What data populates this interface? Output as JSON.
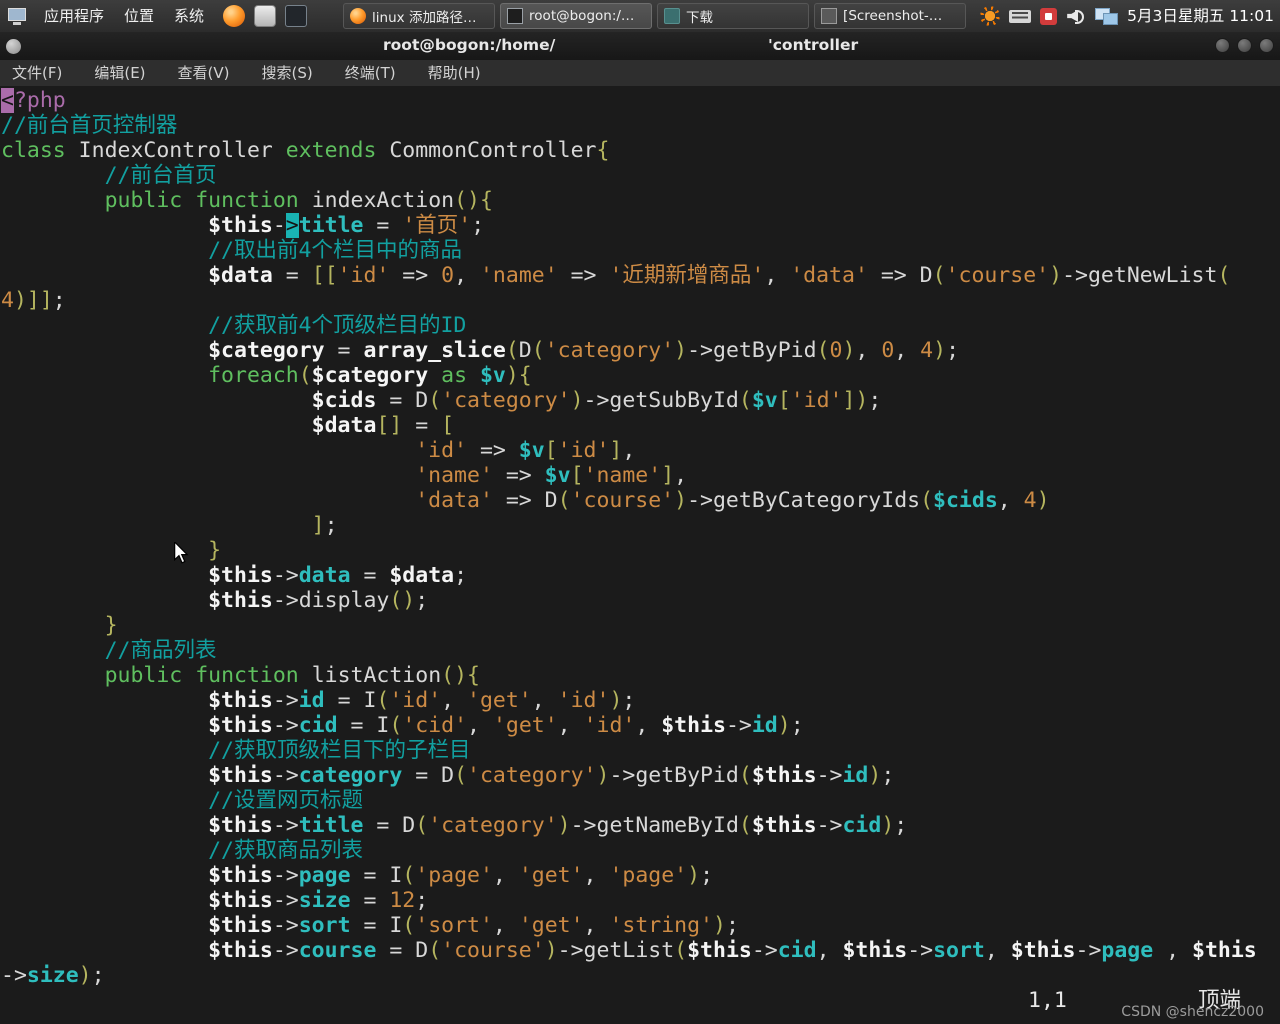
{
  "panel": {
    "menus": [
      {
        "label": "应用程序"
      },
      {
        "label": "位置"
      },
      {
        "label": "系统"
      }
    ],
    "tasks": [
      {
        "label": "linux 添加路径…",
        "icon": "firefox",
        "active": false
      },
      {
        "label": "root@bogon:/…",
        "icon": "terminal",
        "active": true
      },
      {
        "label": "下载",
        "icon": "folder",
        "active": false
      },
      {
        "label": "[Screenshot-…",
        "icon": "image",
        "active": false
      }
    ],
    "clock": "5月3日星期五 11:01"
  },
  "window": {
    "title_left": "root@bogon:/home/",
    "title_right": "'controller"
  },
  "menubar": {
    "items": [
      "文件(F)",
      "编辑(E)",
      "查看(V)",
      "搜索(S)",
      "终端(T)",
      "帮助(H)"
    ]
  },
  "editor": {
    "ruler": "1,1",
    "position_label": "顶端",
    "watermark": "CSDN @shencz2000",
    "syntax_colors": {
      "background": "#1b1b1b",
      "text": "#d8d8d8",
      "comment": "#12a0a0",
      "keyword": "#5fbf5f",
      "string": "#cd8b45",
      "bracket": "#b5b55f",
      "variable": "#f5f5f5",
      "property": "#2fbebe",
      "php_tag": "#aa6caa",
      "cursor": "#19b3b3"
    },
    "lines": [
      [
        [
          "mgb",
          "<"
        ],
        [
          "mg",
          "?php"
        ]
      ],
      [
        [
          "c",
          "//前台首页控制器"
        ]
      ],
      [
        [
          "k",
          "class"
        ],
        [
          "d",
          " IndexController "
        ],
        [
          "k",
          "extends"
        ],
        [
          "d",
          " CommonController"
        ],
        [
          "y",
          "{"
        ]
      ],
      [
        [
          "d",
          "        "
        ],
        [
          "c",
          "//前台首页"
        ]
      ],
      [
        [
          "d",
          "        "
        ],
        [
          "k",
          "public"
        ],
        [
          "d",
          " "
        ],
        [
          "k",
          "function"
        ],
        [
          "d",
          " indexAction"
        ],
        [
          "y",
          "(){"
        ]
      ],
      [
        [
          "d",
          "                "
        ],
        [
          "v",
          "$this"
        ],
        [
          "d",
          "-"
        ],
        [
          "ct",
          ">"
        ],
        [
          "tv",
          "title"
        ],
        [
          "d",
          " = "
        ],
        [
          "s",
          "'首页'"
        ],
        [
          "d",
          ";"
        ]
      ],
      [
        [
          "d",
          "                "
        ],
        [
          "c",
          "//取出前4个栏目中的商品"
        ]
      ],
      [
        [
          "d",
          "                "
        ],
        [
          "v",
          "$data"
        ],
        [
          "d",
          " = "
        ],
        [
          "y",
          "[["
        ],
        [
          "s",
          "'id'"
        ],
        [
          "d",
          " => "
        ],
        [
          "n",
          "0"
        ],
        [
          "d",
          ", "
        ],
        [
          "s",
          "'name'"
        ],
        [
          "d",
          " => "
        ],
        [
          "s",
          "'近期新增商品'"
        ],
        [
          "d",
          ", "
        ],
        [
          "s",
          "'data'"
        ],
        [
          "d",
          " => D"
        ],
        [
          "y",
          "("
        ],
        [
          "s",
          "'course'"
        ],
        [
          "y",
          ")"
        ],
        [
          "d",
          "->getNewList"
        ],
        [
          "y",
          "("
        ]
      ],
      [
        [
          "n",
          "4"
        ],
        [
          "y",
          ")]]"
        ],
        [
          "d",
          ";"
        ]
      ],
      [
        [
          "d",
          "                "
        ],
        [
          "c",
          "//获取前4个顶级栏目的ID"
        ]
      ],
      [
        [
          "d",
          "                "
        ],
        [
          "v",
          "$category"
        ],
        [
          "d",
          " = "
        ],
        [
          "v",
          "array_slice"
        ],
        [
          "y",
          "("
        ],
        [
          "d",
          "D"
        ],
        [
          "y",
          "("
        ],
        [
          "s",
          "'category'"
        ],
        [
          "y",
          ")"
        ],
        [
          "d",
          "->getByPid"
        ],
        [
          "y",
          "("
        ],
        [
          "n",
          "0"
        ],
        [
          "y",
          ")"
        ],
        [
          "d",
          ", "
        ],
        [
          "n",
          "0"
        ],
        [
          "d",
          ", "
        ],
        [
          "n",
          "4"
        ],
        [
          "y",
          ")"
        ],
        [
          "d",
          ";"
        ]
      ],
      [
        [
          "d",
          "                "
        ],
        [
          "k",
          "foreach"
        ],
        [
          "y",
          "("
        ],
        [
          "v",
          "$category"
        ],
        [
          "d",
          " "
        ],
        [
          "k",
          "as"
        ],
        [
          "d",
          " "
        ],
        [
          "tv",
          "$v"
        ],
        [
          "y",
          "){"
        ]
      ],
      [
        [
          "d",
          "                        "
        ],
        [
          "v",
          "$cids"
        ],
        [
          "d",
          " = D"
        ],
        [
          "y",
          "("
        ],
        [
          "s",
          "'category'"
        ],
        [
          "y",
          ")"
        ],
        [
          "d",
          "->getSubById"
        ],
        [
          "y",
          "("
        ],
        [
          "tv",
          "$v"
        ],
        [
          "y",
          "["
        ],
        [
          "s",
          "'id'"
        ],
        [
          "y",
          "])"
        ],
        [
          "d",
          ";"
        ]
      ],
      [
        [
          "d",
          "                        "
        ],
        [
          "v",
          "$data"
        ],
        [
          "y",
          "[]"
        ],
        [
          "d",
          " = "
        ],
        [
          "y",
          "["
        ]
      ],
      [
        [
          "d",
          "                                "
        ],
        [
          "s",
          "'id'"
        ],
        [
          "d",
          " => "
        ],
        [
          "tv",
          "$v"
        ],
        [
          "y",
          "["
        ],
        [
          "s",
          "'id'"
        ],
        [
          "y",
          "]"
        ],
        [
          "d",
          ","
        ]
      ],
      [
        [
          "d",
          "                                "
        ],
        [
          "s",
          "'name'"
        ],
        [
          "d",
          " => "
        ],
        [
          "tv",
          "$v"
        ],
        [
          "y",
          "["
        ],
        [
          "s",
          "'name'"
        ],
        [
          "y",
          "]"
        ],
        [
          "d",
          ","
        ]
      ],
      [
        [
          "d",
          "                                "
        ],
        [
          "s",
          "'data'"
        ],
        [
          "d",
          " => D"
        ],
        [
          "y",
          "("
        ],
        [
          "s",
          "'course'"
        ],
        [
          "y",
          ")"
        ],
        [
          "d",
          "->getByCategoryIds"
        ],
        [
          "y",
          "("
        ],
        [
          "tv",
          "$cids"
        ],
        [
          "d",
          ", "
        ],
        [
          "n",
          "4"
        ],
        [
          "y",
          ")"
        ]
      ],
      [
        [
          "d",
          "                        "
        ],
        [
          "y",
          "]"
        ],
        [
          "d",
          ";"
        ]
      ],
      [
        [
          "d",
          "                "
        ],
        [
          "y",
          "}"
        ]
      ],
      [
        [
          "d",
          "                "
        ],
        [
          "v",
          "$this"
        ],
        [
          "d",
          "->"
        ],
        [
          "tv",
          "data"
        ],
        [
          "d",
          " = "
        ],
        [
          "v",
          "$data"
        ],
        [
          "d",
          ";"
        ]
      ],
      [
        [
          "d",
          "                "
        ],
        [
          "v",
          "$this"
        ],
        [
          "d",
          "->display"
        ],
        [
          "y",
          "()"
        ],
        [
          "d",
          ";"
        ]
      ],
      [
        [
          "d",
          "        "
        ],
        [
          "y",
          "}"
        ]
      ],
      [
        [
          "d",
          "        "
        ],
        [
          "c",
          "//商品列表"
        ]
      ],
      [
        [
          "d",
          "        "
        ],
        [
          "k",
          "public"
        ],
        [
          "d",
          " "
        ],
        [
          "k",
          "function"
        ],
        [
          "d",
          " listAction"
        ],
        [
          "y",
          "(){"
        ]
      ],
      [
        [
          "d",
          "                "
        ],
        [
          "v",
          "$this"
        ],
        [
          "d",
          "->"
        ],
        [
          "tv",
          "id"
        ],
        [
          "d",
          " = I"
        ],
        [
          "y",
          "("
        ],
        [
          "s",
          "'id'"
        ],
        [
          "d",
          ", "
        ],
        [
          "s",
          "'get'"
        ],
        [
          "d",
          ", "
        ],
        [
          "s",
          "'id'"
        ],
        [
          "y",
          ")"
        ],
        [
          "d",
          ";"
        ]
      ],
      [
        [
          "d",
          "                "
        ],
        [
          "v",
          "$this"
        ],
        [
          "d",
          "->"
        ],
        [
          "tv",
          "cid"
        ],
        [
          "d",
          " = I"
        ],
        [
          "y",
          "("
        ],
        [
          "s",
          "'cid'"
        ],
        [
          "d",
          ", "
        ],
        [
          "s",
          "'get'"
        ],
        [
          "d",
          ", "
        ],
        [
          "s",
          "'id'"
        ],
        [
          "d",
          ", "
        ],
        [
          "v",
          "$this"
        ],
        [
          "d",
          "->"
        ],
        [
          "tv",
          "id"
        ],
        [
          "y",
          ")"
        ],
        [
          "d",
          ";"
        ]
      ],
      [
        [
          "d",
          "                "
        ],
        [
          "c",
          "//获取顶级栏目下的子栏目"
        ]
      ],
      [
        [
          "d",
          "                "
        ],
        [
          "v",
          "$this"
        ],
        [
          "d",
          "->"
        ],
        [
          "tv",
          "category"
        ],
        [
          "d",
          " = D"
        ],
        [
          "y",
          "("
        ],
        [
          "s",
          "'category'"
        ],
        [
          "y",
          ")"
        ],
        [
          "d",
          "->getByPid"
        ],
        [
          "y",
          "("
        ],
        [
          "v",
          "$this"
        ],
        [
          "d",
          "->"
        ],
        [
          "tv",
          "id"
        ],
        [
          "y",
          ")"
        ],
        [
          "d",
          ";"
        ]
      ],
      [
        [
          "d",
          "                "
        ],
        [
          "c",
          "//设置网页标题"
        ]
      ],
      [
        [
          "d",
          "                "
        ],
        [
          "v",
          "$this"
        ],
        [
          "d",
          "->"
        ],
        [
          "tv",
          "title"
        ],
        [
          "d",
          " = D"
        ],
        [
          "y",
          "("
        ],
        [
          "s",
          "'category'"
        ],
        [
          "y",
          ")"
        ],
        [
          "d",
          "->getNameById"
        ],
        [
          "y",
          "("
        ],
        [
          "v",
          "$this"
        ],
        [
          "d",
          "->"
        ],
        [
          "tv",
          "cid"
        ],
        [
          "y",
          ")"
        ],
        [
          "d",
          ";"
        ]
      ],
      [
        [
          "d",
          "                "
        ],
        [
          "c",
          "//获取商品列表"
        ]
      ],
      [
        [
          "d",
          "                "
        ],
        [
          "v",
          "$this"
        ],
        [
          "d",
          "->"
        ],
        [
          "tv",
          "page"
        ],
        [
          "d",
          " = I"
        ],
        [
          "y",
          "("
        ],
        [
          "s",
          "'page'"
        ],
        [
          "d",
          ", "
        ],
        [
          "s",
          "'get'"
        ],
        [
          "d",
          ", "
        ],
        [
          "s",
          "'page'"
        ],
        [
          "y",
          ")"
        ],
        [
          "d",
          ";"
        ]
      ],
      [
        [
          "d",
          "                "
        ],
        [
          "v",
          "$this"
        ],
        [
          "d",
          "->"
        ],
        [
          "tv",
          "size"
        ],
        [
          "d",
          " = "
        ],
        [
          "n",
          "12"
        ],
        [
          "d",
          ";"
        ]
      ],
      [
        [
          "d",
          "                "
        ],
        [
          "v",
          "$this"
        ],
        [
          "d",
          "->"
        ],
        [
          "tv",
          "sort"
        ],
        [
          "d",
          " = I"
        ],
        [
          "y",
          "("
        ],
        [
          "s",
          "'sort'"
        ],
        [
          "d",
          ", "
        ],
        [
          "s",
          "'get'"
        ],
        [
          "d",
          ", "
        ],
        [
          "s",
          "'string'"
        ],
        [
          "y",
          ")"
        ],
        [
          "d",
          ";"
        ]
      ],
      [
        [
          "d",
          "                "
        ],
        [
          "v",
          "$this"
        ],
        [
          "d",
          "->"
        ],
        [
          "tv",
          "course"
        ],
        [
          "d",
          " = D"
        ],
        [
          "y",
          "("
        ],
        [
          "s",
          "'course'"
        ],
        [
          "y",
          ")"
        ],
        [
          "d",
          "->getList"
        ],
        [
          "y",
          "("
        ],
        [
          "v",
          "$this"
        ],
        [
          "d",
          "->"
        ],
        [
          "tv",
          "cid"
        ],
        [
          "d",
          ", "
        ],
        [
          "v",
          "$this"
        ],
        [
          "d",
          "->"
        ],
        [
          "tv",
          "sort"
        ],
        [
          "d",
          ", "
        ],
        [
          "v",
          "$this"
        ],
        [
          "d",
          "->"
        ],
        [
          "tv",
          "page"
        ],
        [
          "d",
          " , "
        ],
        [
          "v",
          "$this"
        ]
      ],
      [
        [
          "d",
          "->"
        ],
        [
          "tv",
          "size"
        ],
        [
          "y",
          ")"
        ],
        [
          "d",
          ";"
        ]
      ]
    ]
  }
}
